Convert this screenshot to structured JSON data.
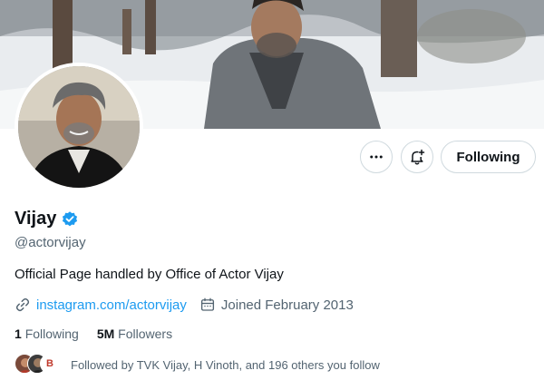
{
  "profile": {
    "name": "Vijay",
    "handle": "@actorvijay",
    "bio": "Official Page handled by Office of Actor Vijay",
    "website": "instagram.com/actorvijay",
    "joined": "Joined February 2013",
    "following_count": "1",
    "following_label": "Following",
    "followers_count": "5M",
    "followers_label": "Followers",
    "followed_by": "Followed by TVK Vijay, H Vinoth, and 196 others you follow",
    "follow_button": "Following",
    "mini_avatar_letter": "B"
  },
  "icons": {
    "more": "more-icon",
    "notify": "bell-plus-icon",
    "verified": "verified-badge-icon",
    "link": "link-icon",
    "calendar": "calendar-icon"
  },
  "colors": {
    "accent": "#1d9bf0",
    "text": "#0f1419",
    "muted": "#536471",
    "border": "#cfd9de"
  }
}
